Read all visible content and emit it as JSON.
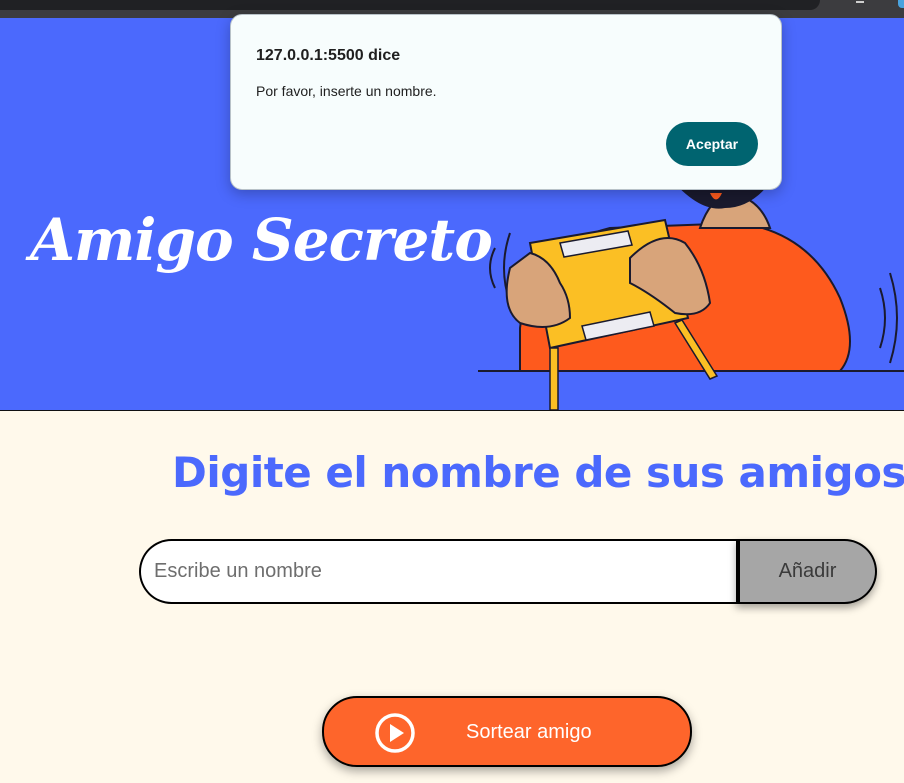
{
  "browser": {
    "dialog": {
      "title": "127.0.0.1:5500 dice",
      "message": "Por favor, inserte un nombre.",
      "ok_label": "Aceptar"
    }
  },
  "hero": {
    "title": "Amigo Secreto",
    "illustration_icon": "person-holding-gift-illustration"
  },
  "main": {
    "section_title": "Digite el nombre de sus amigos",
    "input": {
      "placeholder": "Escribe un nombre",
      "value": ""
    },
    "add_label": "Añadir",
    "draw_label": "Sortear amigo",
    "draw_icon": "play-circle-icon"
  },
  "colors": {
    "hero_bg": "#4b69fd",
    "page_bg": "#fff9eb",
    "title_blue": "#4b69fd",
    "draw_button": "#fe652b",
    "add_button": "#a6a6a6",
    "dialog_button": "#006470"
  }
}
